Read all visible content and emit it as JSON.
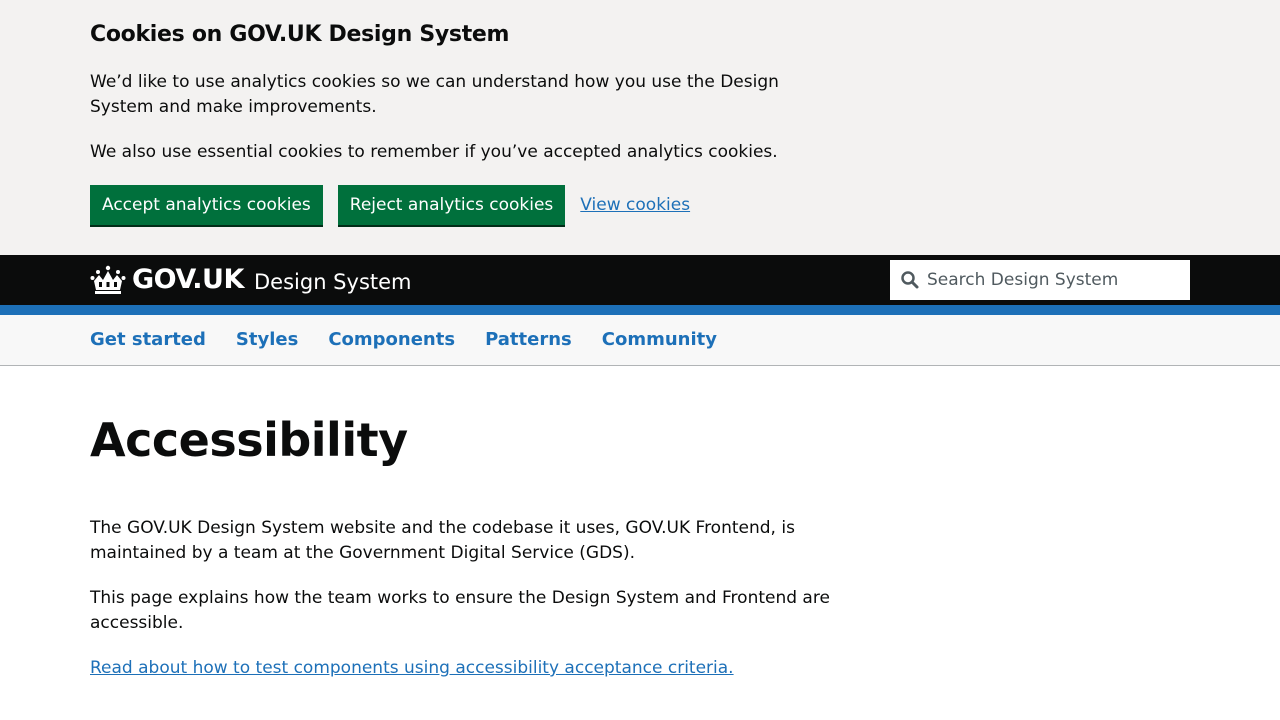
{
  "cookie_banner": {
    "title": "Cookies on GOV.UK Design System",
    "paragraph_1": "We’d like to use analytics cookies so we can understand how you use the Design System and make improvements.",
    "paragraph_2": "We also use essential cookies to remember if you’ve accepted analytics cookies.",
    "accept_label": "Accept analytics cookies",
    "reject_label": "Reject analytics cookies",
    "view_label": "View cookies"
  },
  "header": {
    "logo_text": "GOV.UK",
    "product_name": "Design System",
    "logo_icon": "crown-icon",
    "search": {
      "icon": "search-icon",
      "placeholder": "Search Design System",
      "value": ""
    }
  },
  "nav": {
    "items": [
      {
        "label": "Get started"
      },
      {
        "label": "Styles"
      },
      {
        "label": "Components"
      },
      {
        "label": "Patterns"
      },
      {
        "label": "Community"
      }
    ]
  },
  "main": {
    "title": "Accessibility",
    "paragraph_1": "The GOV.UK Design System website and the codebase it uses, GOV.UK Frontend, is maintained by a team at the Government Digital Service (GDS).",
    "paragraph_2": "This page explains how the team works to ensure the Design System and Frontend are accessible.",
    "link_label": "Read about how to test components using accessibility acceptance criteria."
  },
  "colors": {
    "banner_background": "#f3f2f1",
    "button_green": "#00703c",
    "header_black": "#0b0c0c",
    "brand_blue": "#1d70b8",
    "nav_background": "#f8f8f8"
  }
}
